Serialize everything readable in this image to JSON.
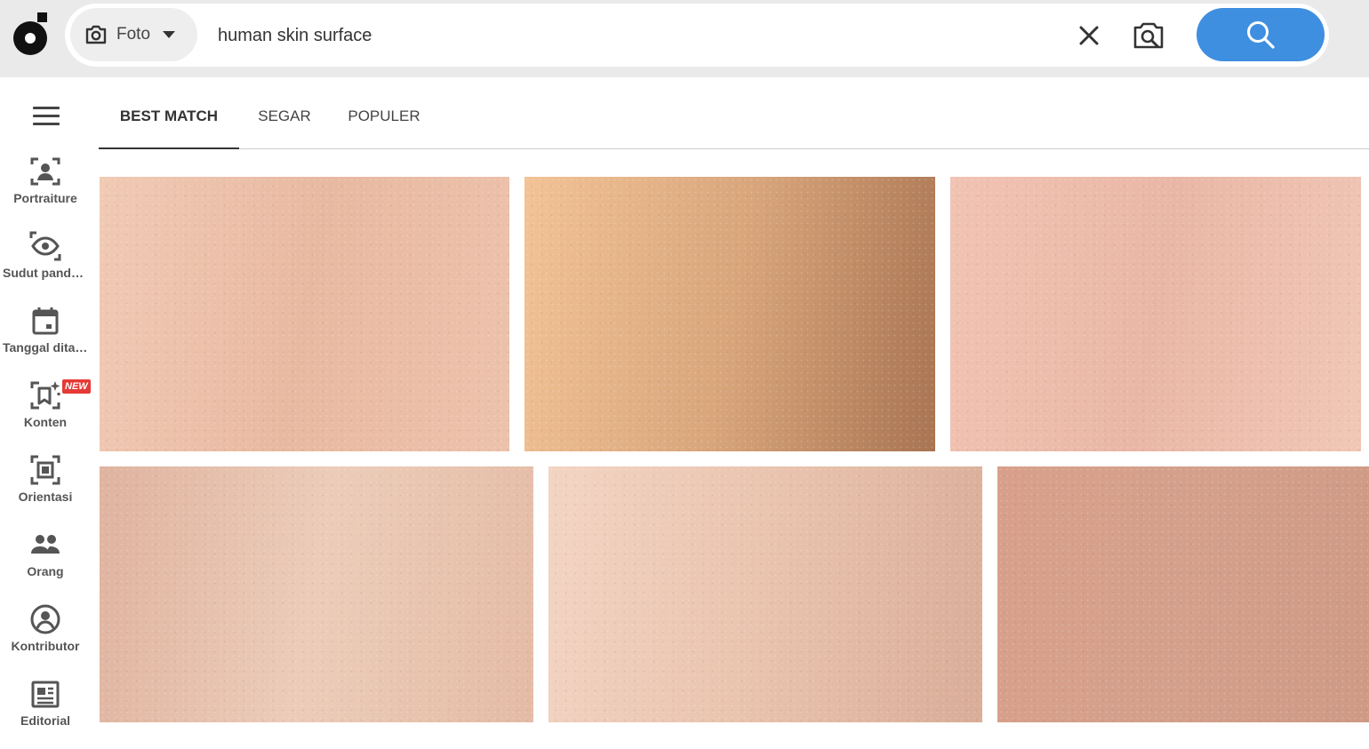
{
  "search": {
    "type_label": "Foto",
    "query": "human skin surface"
  },
  "icons": {
    "logo": "logo-icon",
    "camera": "camera-icon",
    "dropdown": "chevron-down-icon",
    "clear": "close-icon",
    "visual_search": "visual-search-icon",
    "search": "search-icon",
    "menu": "hamburger-menu-icon"
  },
  "colors": {
    "accent": "#3f8fe0",
    "new_badge": "#e53935",
    "topbar": "#eaeaea"
  },
  "sidebar": {
    "items": [
      {
        "label": "Portraiture",
        "icon": "portrait-icon"
      },
      {
        "label": "Sudut pandang",
        "icon": "viewpoint-eye-icon"
      },
      {
        "label": "Tanggal ditambahkan",
        "icon": "calendar-icon"
      },
      {
        "label": "Konten",
        "icon": "content-sparkle-icon",
        "badge": "NEW"
      },
      {
        "label": "Orientasi",
        "icon": "orientation-icon"
      },
      {
        "label": "Orang",
        "icon": "people-icon"
      },
      {
        "label": "Kontributor",
        "icon": "contributor-icon"
      },
      {
        "label": "Editorial",
        "icon": "editorial-icon"
      }
    ]
  },
  "tabs": [
    {
      "label": "BEST MATCH",
      "active": true
    },
    {
      "label": "SEGAR",
      "active": false
    },
    {
      "label": "POPULER",
      "active": false
    }
  ],
  "results": [
    {
      "colors": [
        "#f1cab4",
        "#e8b9a1",
        "#edc2ab"
      ]
    },
    {
      "colors": [
        "#f2c396",
        "#d9a67c",
        "#a87452"
      ]
    },
    {
      "colors": [
        "#f1c3b3",
        "#eab7a6",
        "#f0c7b6"
      ]
    },
    {
      "colors": [
        "#dfb39f",
        "#ecccb9",
        "#e4bba5"
      ]
    },
    {
      "colors": [
        "#f3d4c3",
        "#e9c3ae",
        "#d9ad97"
      ]
    },
    {
      "colors": [
        "#d8a08a",
        "#d4a08b",
        "#cf9a85"
      ]
    }
  ]
}
